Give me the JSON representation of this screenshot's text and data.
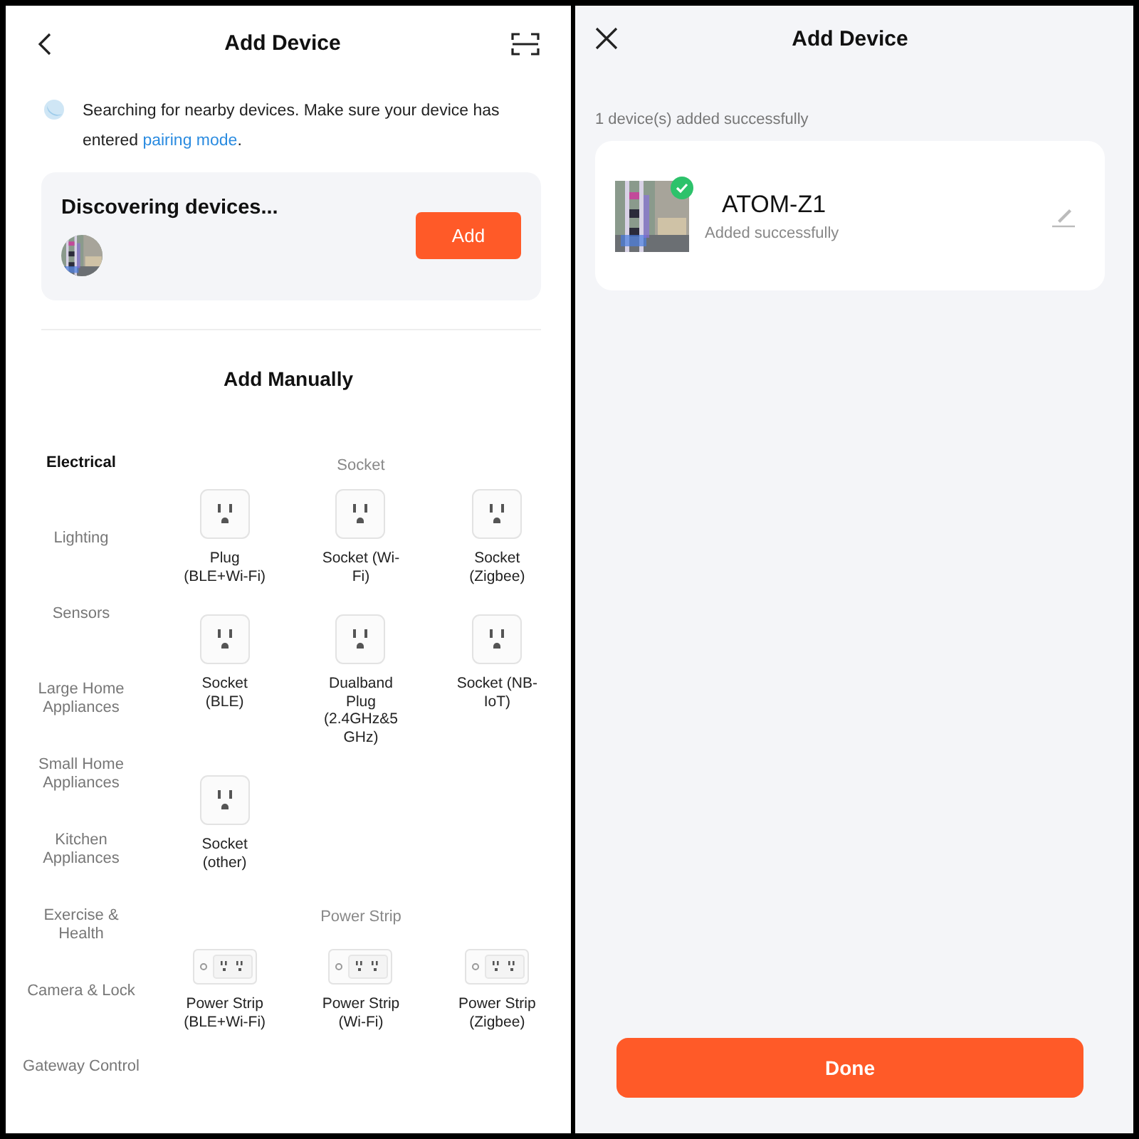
{
  "left": {
    "title": "Add Device",
    "notice": {
      "text": "Searching for nearby devices. Make sure your device has entered ",
      "link": "pairing mode",
      "after": "."
    },
    "discovery": {
      "title": "Discovering devices...",
      "button": "Add"
    },
    "section_title": "Add Manually",
    "categories": [
      {
        "label": "Electrical",
        "selected": true
      },
      {
        "label": "Lighting",
        "selected": false
      },
      {
        "label": "Sensors",
        "selected": false
      },
      {
        "label": "Large Home Appliances",
        "selected": false
      },
      {
        "label": "Small Home Appliances",
        "selected": false
      },
      {
        "label": "Kitchen Appliances",
        "selected": false
      },
      {
        "label": "Exercise & Health",
        "selected": false
      },
      {
        "label": "Camera & Lock",
        "selected": false
      },
      {
        "label": "Gateway Control",
        "selected": false
      }
    ],
    "groups": [
      {
        "title": "Socket",
        "kind": "socket",
        "items": [
          "Plug (BLE+Wi-Fi)",
          "Socket (Wi-Fi)",
          "Socket (Zigbee)",
          "Socket (BLE)",
          "Dualband Plug (2.4GHz&5GHz)",
          "Socket (NB-IoT)",
          "Socket (other)"
        ]
      },
      {
        "title": "Power Strip",
        "kind": "strip",
        "items": [
          "Power Strip (BLE+Wi-Fi)",
          "Power Strip (Wi-Fi)",
          "Power Strip (Zigbee)"
        ]
      }
    ]
  },
  "right": {
    "title": "Add Device",
    "summary": "1 device(s) added successfully",
    "devices": [
      {
        "name": "ATOM-Z1",
        "status": "Added successfully",
        "added": true
      }
    ],
    "button": "Done"
  }
}
